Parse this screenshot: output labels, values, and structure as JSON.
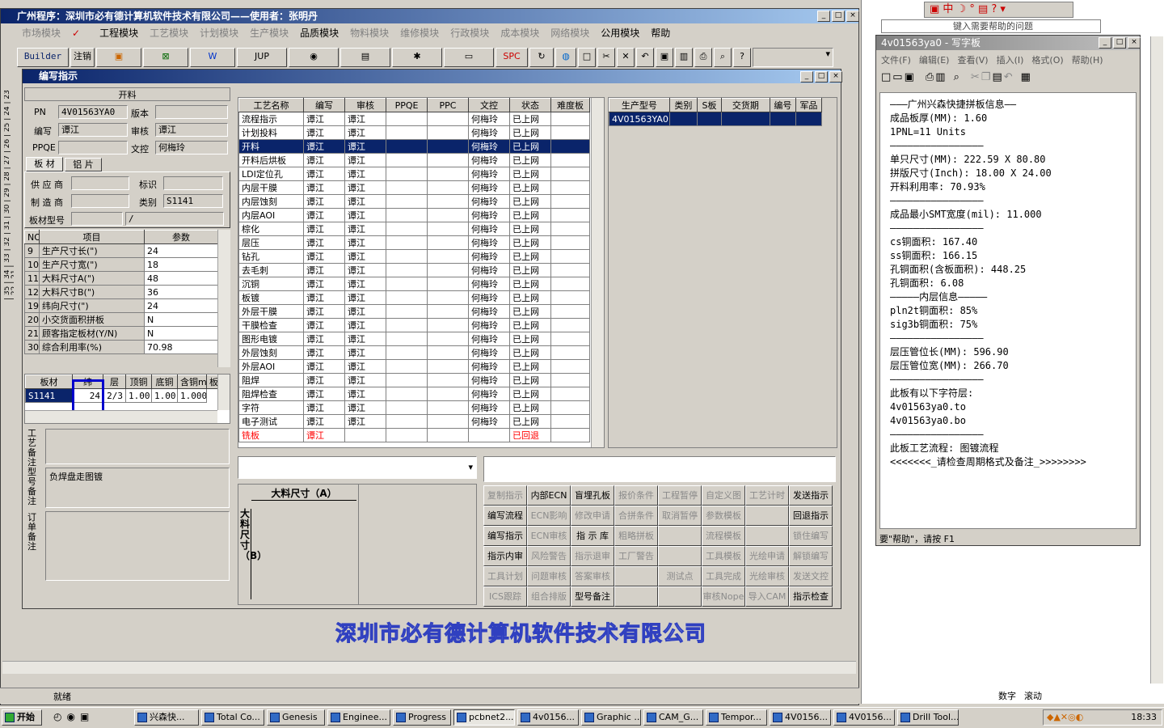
{
  "main_window": {
    "title": "广州程序：深圳市必有德计算机软件技术有限公司——使用者：张明丹"
  },
  "menu": [
    "市场模块",
    "工程模块",
    "工艺模块",
    "计划模块",
    "生产模块",
    "品质模块",
    "物料模块",
    "维修模块",
    "行政模块",
    "成本模块",
    "网络模块",
    "公用模块",
    "帮助"
  ],
  "toolbar": {
    "builder": "Builder",
    "logout": "注销",
    "jup": "JUP",
    "spc": "SPC"
  },
  "dialog": {
    "title": "编写指示",
    "section": "开料",
    "pn_label": "PN",
    "pn": "4V01563YA0",
    "version_label": "版本",
    "version": "",
    "writer_label": "编写",
    "writer": "谭江",
    "reviewer_label": "审核",
    "reviewer": "谭江",
    "ppqe_label": "PPQE",
    "ppqe": "",
    "doc_label": "文控",
    "doc": "何梅玲",
    "tab_board": "板 材",
    "tab_alu": "铝 片",
    "supplier_label": "供 应 商",
    "mark_label": "标识",
    "maker_label": "制 造 商",
    "category_label": "类别",
    "category": "S1141",
    "boardtype_label": "板材型号",
    "boardtype": "/",
    "params_header": [
      "NO",
      "项目",
      "参数"
    ],
    "params": [
      [
        "9",
        "生产尺寸长(\")",
        "24"
      ],
      [
        "10",
        "生产尺寸宽(\")",
        "18"
      ],
      [
        "11",
        "大料尺寸A(\")",
        "48"
      ],
      [
        "12",
        "大料尺寸B(\")",
        "36"
      ],
      [
        "19",
        "纬向尺寸(\")",
        "24"
      ],
      [
        "20",
        "小交货面积拼板",
        "N"
      ],
      [
        "21",
        "顾客指定板材(Y/N)",
        "N"
      ],
      [
        "30",
        "综合利用率(%)",
        "70.98"
      ]
    ],
    "mat_header": [
      "板材",
      "纬",
      "层",
      "顶铜",
      "底铜",
      "含铜mm",
      "板"
    ],
    "mat_row": [
      "S1141",
      "24",
      "2/3",
      "1.00",
      "1.00",
      "1.000"
    ],
    "note1_label": "工艺备注",
    "note2_label": "型号备注",
    "note2": "负焊盘走图镀",
    "note3_label": "订单备注",
    "proc_header": [
      "工艺名称",
      "编写",
      "审核",
      "PPQE",
      "PPC",
      "文控",
      "状态",
      "难度板"
    ],
    "processes": [
      [
        "流程指示",
        "谭江",
        "谭江",
        "",
        "",
        "何梅玲",
        "已上网"
      ],
      [
        "计划投料",
        "谭江",
        "谭江",
        "",
        "",
        "何梅玲",
        "已上网"
      ],
      [
        "开料",
        "谭江",
        "谭江",
        "",
        "",
        "何梅玲",
        "已上网"
      ],
      [
        "开料后烘板",
        "谭江",
        "谭江",
        "",
        "",
        "何梅玲",
        "已上网"
      ],
      [
        "LDI定位孔",
        "谭江",
        "谭江",
        "",
        "",
        "何梅玲",
        "已上网"
      ],
      [
        "内层干膜",
        "谭江",
        "谭江",
        "",
        "",
        "何梅玲",
        "已上网"
      ],
      [
        "内层蚀刻",
        "谭江",
        "谭江",
        "",
        "",
        "何梅玲",
        "已上网"
      ],
      [
        "内层AOI",
        "谭江",
        "谭江",
        "",
        "",
        "何梅玲",
        "已上网"
      ],
      [
        "棕化",
        "谭江",
        "谭江",
        "",
        "",
        "何梅玲",
        "已上网"
      ],
      [
        "层压",
        "谭江",
        "谭江",
        "",
        "",
        "何梅玲",
        "已上网"
      ],
      [
        "钻孔",
        "谭江",
        "谭江",
        "",
        "",
        "何梅玲",
        "已上网"
      ],
      [
        "去毛刺",
        "谭江",
        "谭江",
        "",
        "",
        "何梅玲",
        "已上网"
      ],
      [
        "沉铜",
        "谭江",
        "谭江",
        "",
        "",
        "何梅玲",
        "已上网"
      ],
      [
        "板镀",
        "谭江",
        "谭江",
        "",
        "",
        "何梅玲",
        "已上网"
      ],
      [
        "外层干膜",
        "谭江",
        "谭江",
        "",
        "",
        "何梅玲",
        "已上网"
      ],
      [
        "干膜检查",
        "谭江",
        "谭江",
        "",
        "",
        "何梅玲",
        "已上网"
      ],
      [
        "图形电镀",
        "谭江",
        "谭江",
        "",
        "",
        "何梅玲",
        "已上网"
      ],
      [
        "外层蚀刻",
        "谭江",
        "谭江",
        "",
        "",
        "何梅玲",
        "已上网"
      ],
      [
        "外层AOI",
        "谭江",
        "谭江",
        "",
        "",
        "何梅玲",
        "已上网"
      ],
      [
        "阻焊",
        "谭江",
        "谭江",
        "",
        "",
        "何梅玲",
        "已上网"
      ],
      [
        "阻焊检查",
        "谭江",
        "谭江",
        "",
        "",
        "何梅玲",
        "已上网"
      ],
      [
        "字符",
        "谭江",
        "谭江",
        "",
        "",
        "何梅玲",
        "已上网"
      ],
      [
        "电子测试",
        "谭江",
        "谭江",
        "",
        "",
        "何梅玲",
        "已上网"
      ],
      [
        "铣板",
        "谭江",
        "",
        "",
        "",
        "",
        "已回退"
      ]
    ],
    "model_header": [
      "生产型号",
      "类别",
      "S板",
      "交货期",
      "编号",
      "军品"
    ],
    "model_row": [
      "4V01563YA0",
      "",
      "",
      "",
      "",
      ""
    ],
    "dim_a": "大料尺寸（A）",
    "dim_b": "大料尺寸（B）",
    "buttons": [
      [
        "复制指示",
        "内部ECN",
        "盲埋孔板",
        "报价条件",
        "工程暂停",
        "自定义图",
        "工艺计时",
        "发送指示"
      ],
      [
        "编写流程",
        "ECN影响",
        "修改申请",
        "合拼条件",
        "取消暂停",
        "参数模板",
        "",
        "回退指示"
      ],
      [
        "编写指示",
        "ECN审核",
        "指 示 库",
        "粗略拼板",
        "",
        "流程模板",
        "",
        "锁住编写"
      ],
      [
        "指示内审",
        "风险警告",
        "指示退审",
        "工厂警告",
        "",
        "工具模板",
        "光绘申请",
        "解锁编写"
      ],
      [
        "工具计划",
        "问题审核",
        "答案审核",
        "",
        "测试点",
        "工具完成",
        "光绘审核",
        "发送文控"
      ],
      [
        "ICS跟踪",
        "组合排版",
        "型号备注",
        "",
        "",
        "审核Nope",
        "导入CAM",
        "指示检查"
      ]
    ],
    "enabled": [
      "内部ECN",
      "盲埋孔板",
      "发送指示",
      "编写流程",
      "回退指示",
      "编写指示",
      "指 示 库",
      "指示内审",
      "型号备注",
      "指示检查"
    ]
  },
  "company_banner": "深圳市必有德计算机软件技术有限公司",
  "statusbar": "就绪",
  "wordpad": {
    "title": "4v01563ya0 - 写字板",
    "menu": [
      "文件(F)",
      "编辑(E)",
      "查看(V)",
      "插入(I)",
      "格式(O)",
      "帮助(H)"
    ],
    "lines": [
      "———广州兴森快捷拼板信息——",
      "成品板厚(MM): 1.60",
      "1PNL=11 Units",
      "————————————————",
      "单只尺寸(MM): 222.59 X 80.80",
      "拼版尺寸(Inch): 18.00 X 24.00",
      "开料利用率: 70.93%",
      "————————————————",
      "成品最小SMT宽度(mil): 11.000",
      "————————————————",
      "cs铜面积: 167.40",
      "ss铜面积: 166.15",
      "孔铜面积(含板面积): 448.25",
      "孔铜面积: 6.08",
      "—————内层信息—————",
      "pln2t铜面积: 85%",
      "sig3b铜面积: 75%",
      "————————————————",
      "层压管位长(MM): 596.90",
      "层压管位宽(MM): 266.70",
      "————————————————",
      "此板有以下字符层:",
      "4v01563ya0.to",
      "4v01563ya0.bo",
      "————————————————",
      "此板工艺流程: 图镀流程",
      "<<<<<<<_请检查周期格式及备注_>>>>>>>>"
    ],
    "status": "要\"帮助\"，请按 F1"
  },
  "help_box": "键入需要帮助的问题",
  "right_status": [
    "数字",
    "滚动"
  ],
  "taskbar": {
    "start": "开始",
    "tasks": [
      "兴森快...",
      "Total Co...",
      "Genesis",
      "Enginee...",
      "Progress",
      "pcbnet2...",
      "4v0156...",
      "Graphic ...",
      "CAM_G...",
      "Tempor...",
      "4V0156...",
      "4V0156...",
      "Drill Tool..."
    ],
    "time": "18:33"
  },
  "side_ruler": "| 35 | 34 | 33 | 32 | 31 | 30 | 29 | 28 | 27 | 26 | 25 | 24 | 23 | 22 | 21 |"
}
